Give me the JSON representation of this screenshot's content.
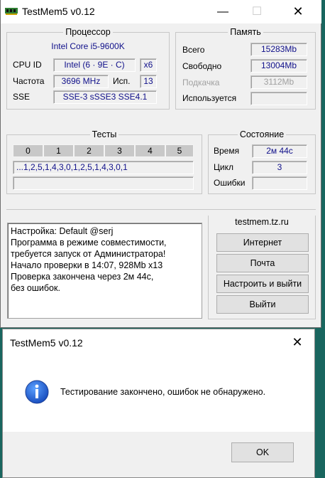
{
  "main_window": {
    "title": "TestMem5 v0.12",
    "controls": {
      "minimize": "—",
      "maximize": "☐",
      "close": "✕"
    },
    "processor": {
      "legend": "Процессор",
      "name": "Intel Core i5-9600K",
      "cpu_id_label": "CPU ID",
      "cpu_id_value": "Intel (6 · 9E · C)",
      "cpu_id_threads": "x6",
      "freq_label": "Частота",
      "freq_value": "3696 MHz",
      "used_label": "Исп.",
      "used_value": "13",
      "sse_label": "SSE",
      "sse_value": "SSE-3 sSSE3 SSE4.1"
    },
    "memory": {
      "legend": "Память",
      "rows": [
        {
          "label": "Всего",
          "value": "15283Mb",
          "disabled": false
        },
        {
          "label": "Свободно",
          "value": "13004Mb",
          "disabled": false
        },
        {
          "label": "Подкачка",
          "value": "3112Mb",
          "disabled": true
        },
        {
          "label": "Используется",
          "value": "",
          "disabled": false
        }
      ]
    },
    "tests": {
      "legend": "Тесты",
      "columns": [
        "0",
        "1",
        "2",
        "3",
        "4",
        "5"
      ],
      "sequence": "...1,2,5,1,4,3,0,1,2,5,1,4,3,0,1",
      "progress": ""
    },
    "status": {
      "legend": "Состояние",
      "time_label": "Время",
      "time_value": "2м 44с",
      "cycle_label": "Цикл",
      "cycle_value": "3",
      "errors_label": "Ошибки",
      "errors_value": ""
    },
    "links": {
      "site": "testmem.tz.ru",
      "internet_button": "Интернет",
      "mail_button": "Почта",
      "configure_exit_button": "Настроить и выйти",
      "exit_button": "Выйти"
    },
    "log_lines": [
      "Настройка: Default @serj",
      "Программа в режиме совместимости,",
      "требуется запуск от Администратора!",
      "Начало проверки в 14:07, 928Mb x13",
      "Проверка закончена через 2м 44с,",
      "без ошибок."
    ]
  },
  "dialog": {
    "title": "TestMem5 v0.12",
    "close": "✕",
    "message": "Тестирование закончено, ошибок не обнаружено.",
    "ok_button": "OK",
    "icon": "info-icon"
  },
  "colors": {
    "desktop": "#19665f",
    "value_text": "#10108a",
    "window_bg": "#f0f0f0"
  }
}
